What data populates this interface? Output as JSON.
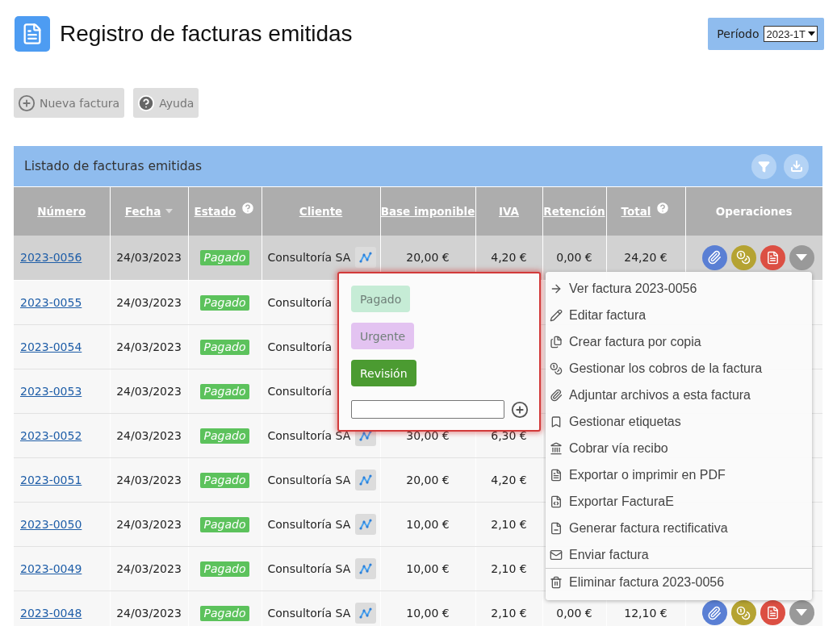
{
  "page": {
    "title": "Registro de facturas emitidas"
  },
  "period": {
    "label": "Período",
    "value": "2023-1T"
  },
  "toolbar": [
    {
      "label": "Nueva factura",
      "disabled": true
    },
    {
      "label": "Ayuda",
      "disabled": true
    }
  ],
  "panel": {
    "title": "Listado de facturas emitidas"
  },
  "table": {
    "columns": [
      {
        "label": "Número",
        "link": true,
        "sorted": false,
        "help": false
      },
      {
        "label": "Fecha",
        "link": true,
        "sorted": true,
        "help": false
      },
      {
        "label": "Estado",
        "link": true,
        "sorted": false,
        "help": true
      },
      {
        "label": "Cliente",
        "link": true,
        "sorted": false,
        "help": false
      },
      {
        "label": "Base imponible",
        "link": true,
        "sorted": false,
        "help": false
      },
      {
        "label": "IVA",
        "link": true,
        "sorted": false,
        "help": false
      },
      {
        "label": "Retención",
        "link": true,
        "sorted": false,
        "help": false
      },
      {
        "label": "Total",
        "link": true,
        "sorted": false,
        "help": true
      },
      {
        "label": "Operaciones",
        "link": false,
        "sorted": false,
        "help": false
      }
    ],
    "rows": [
      {
        "selected": true,
        "number": "2023-0056",
        "date": "24/03/2023",
        "status": "Pagado",
        "client": "Consultoría SA",
        "chart_button": true,
        "base": "20,00 €",
        "iva": "4,20 €",
        "retention": "0,00 €",
        "total": "24,20 €",
        "operations": true
      },
      {
        "selected": false,
        "number": "2023-0055",
        "date": "24/03/2023",
        "status": "Pagado",
        "client": "Consultoría",
        "chart_button": false,
        "operations": false
      },
      {
        "selected": false,
        "number": "2023-0054",
        "date": "24/03/2023",
        "status": "Pagado",
        "client": "Consultoría",
        "chart_button": false,
        "operations": false
      },
      {
        "selected": false,
        "number": "2023-0053",
        "date": "24/03/2023",
        "status": "Pagado",
        "client": "Consultoría",
        "chart_button": false,
        "operations": false
      },
      {
        "selected": false,
        "number": "2023-0052",
        "date": "24/03/2023",
        "status": "Pagado",
        "client": "Consultoría SA",
        "chart_button": true,
        "base": "30,00 €",
        "iva": "6,30 €",
        "operations": false
      },
      {
        "selected": false,
        "number": "2023-0051",
        "date": "24/03/2023",
        "status": "Pagado",
        "client": "Consultoría SA",
        "chart_button": true,
        "base": "20,00 €",
        "iva": "4,20 €",
        "operations": false
      },
      {
        "selected": false,
        "number": "2023-0050",
        "date": "24/03/2023",
        "status": "Pagado",
        "client": "Consultoría SA",
        "chart_button": true,
        "base": "10,00 €",
        "iva": "2,10 €",
        "operations": false
      },
      {
        "selected": false,
        "number": "2023-0049",
        "date": "24/03/2023",
        "status": "Pagado",
        "client": "Consultoría SA",
        "chart_button": true,
        "base": "10,00 €",
        "iva": "2,10 €",
        "operations": false
      },
      {
        "selected": false,
        "number": "2023-0048",
        "date": "24/03/2023",
        "status": "Pagado",
        "client": "Consultoría SA",
        "chart_button": true,
        "base": "10,00 €",
        "iva": "2,10 €",
        "retention": "0,00 €",
        "total": "12,10 €",
        "operations": true
      }
    ]
  },
  "tag_popup": {
    "tags": [
      {
        "label": "Pagado",
        "color": "#c6ecd6"
      },
      {
        "label": "Urgente",
        "color": "#e3c3f1"
      },
      {
        "label": "Revisión",
        "color": "#4b9b31"
      }
    ]
  },
  "menu": {
    "items": [
      {
        "label": "Ver factura 2023-0056",
        "divider_before": false
      },
      {
        "label": "Editar factura",
        "divider_before": false
      },
      {
        "label": "Crear factura por copia",
        "divider_before": false
      },
      {
        "label": "Gestionar los cobros de la factura",
        "divider_before": false
      },
      {
        "label": "Adjuntar archivos a esta factura",
        "divider_before": false
      },
      {
        "label": "Gestionar etiquetas",
        "divider_before": false
      },
      {
        "label": "Cobrar vía recibo",
        "divider_before": false
      },
      {
        "label": "Exportar o imprimir en PDF",
        "divider_before": false
      },
      {
        "label": "Exportar FacturaE",
        "divider_before": false
      },
      {
        "label": "Generar factura rectificativa",
        "divider_before": false
      },
      {
        "label": "Enviar factura",
        "divider_before": false
      },
      {
        "label": "Eliminar factura 2023-0056",
        "divider_before": true
      }
    ]
  }
}
